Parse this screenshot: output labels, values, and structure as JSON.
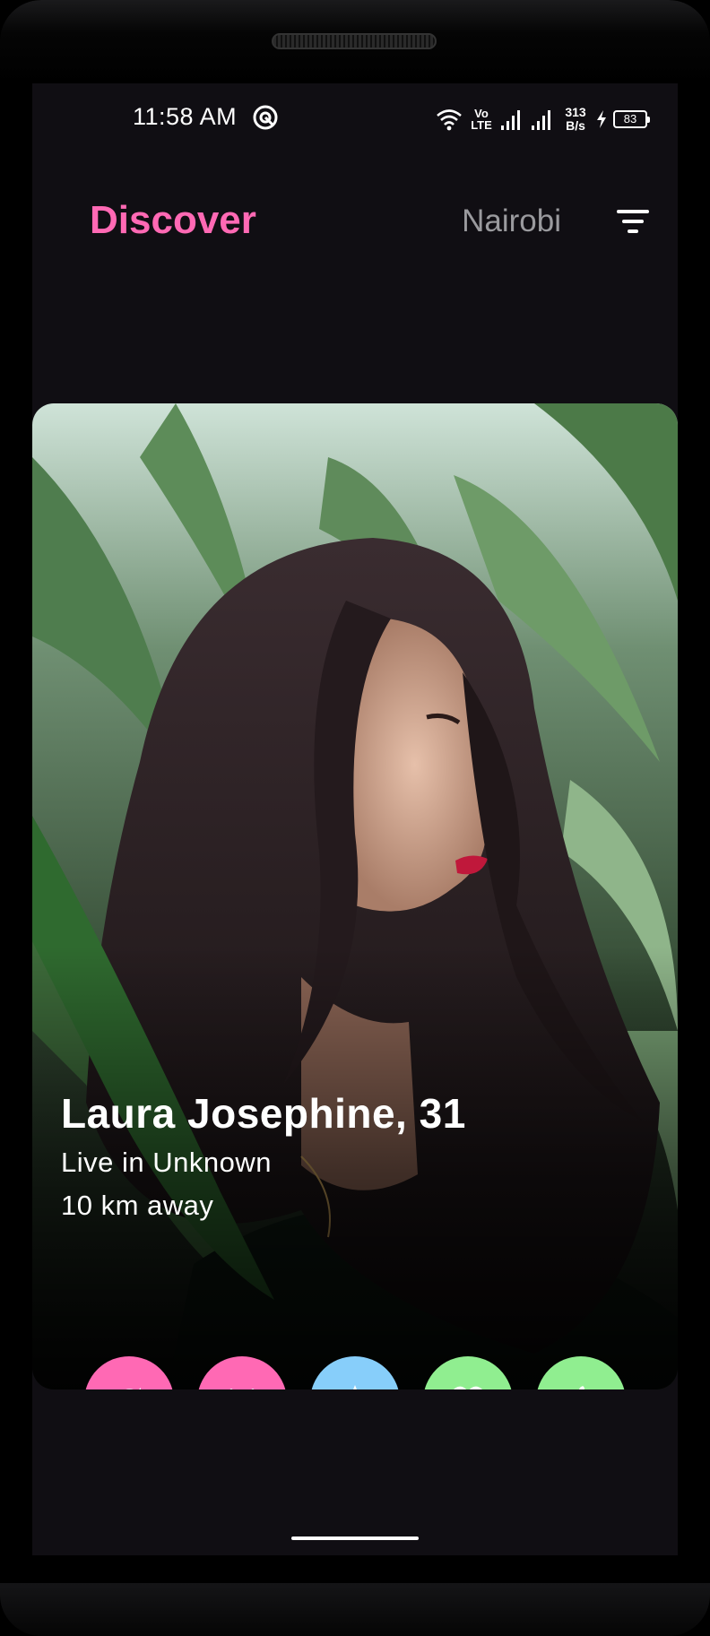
{
  "status_bar": {
    "time": "11:58 AM",
    "volte_top": "Vo",
    "volte_bottom": "LTE",
    "speed_value": "313",
    "speed_unit": "B/s",
    "battery": "83"
  },
  "header": {
    "title": "Discover",
    "location": "Nairobi"
  },
  "profile": {
    "name_age": "Laura Josephine, 31",
    "lives_in": "Live in Unknown",
    "distance": "10 km away"
  },
  "actions": [
    {
      "icon": "refresh-icon",
      "color": "#ff69b4"
    },
    {
      "icon": "close-icon",
      "color": "#ff69b4"
    },
    {
      "icon": "star-icon",
      "color": "#87cefa"
    },
    {
      "icon": "heart-icon",
      "color": "#90ee90"
    },
    {
      "icon": "thumbs-up-icon",
      "color": "#90ee90"
    }
  ],
  "colors": {
    "accent": "#ff69b4",
    "background": "#100e13"
  }
}
